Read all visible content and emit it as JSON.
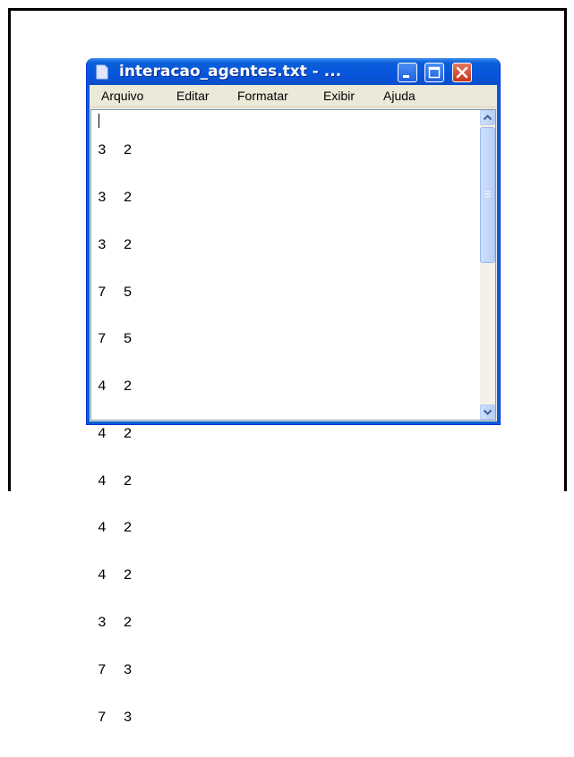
{
  "window": {
    "title": "interacao_agentes.txt - ...",
    "accent": "#0a5fd8"
  },
  "menu": [
    {
      "label": "Arquivo"
    },
    {
      "label": "Editar"
    },
    {
      "label": "Formatar"
    },
    {
      "label": "Exibir"
    },
    {
      "label": "Ajuda"
    }
  ],
  "content": {
    "lines": [
      "3  2",
      "3  2",
      "3  2",
      "7  5",
      "7  5",
      "4  2",
      "4  2",
      "4  2",
      "4  2",
      "4  2",
      "3  2",
      "7  3",
      "7  3"
    ]
  },
  "icons": {
    "app": "notepad-document-icon",
    "minimize": "minimize-icon",
    "maximize": "maximize-icon",
    "close": "close-icon",
    "scroll_up": "chevron-up-icon",
    "scroll_down": "chevron-down-icon"
  }
}
